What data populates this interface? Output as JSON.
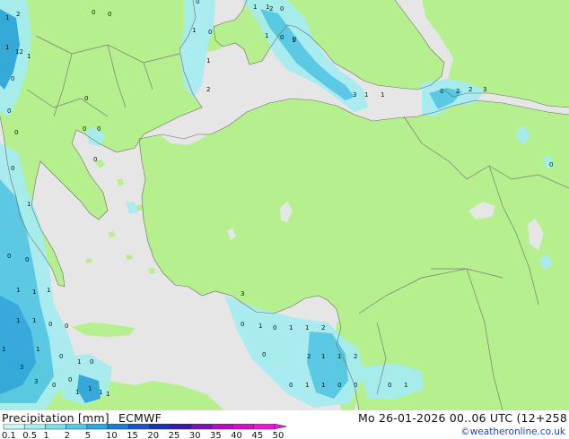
{
  "legend": {
    "title": "Precipitation [mm]",
    "model": "ECMWF",
    "ticks": [
      "0.1",
      "0.5",
      "1",
      "2",
      "5",
      "10",
      "15",
      "20",
      "25",
      "30",
      "35",
      "40",
      "45",
      "50"
    ],
    "colors": [
      "#ccf5f5",
      "#a6ecf0",
      "#7cdfe8",
      "#55c8e4",
      "#2fa6dc",
      "#1d7ad6",
      "#1c53c8",
      "#1b34ae",
      "#3a1aa8",
      "#7a14b8",
      "#b010c4",
      "#d20ec8",
      "#e81ad0"
    ]
  },
  "timestamp": "Mo 26-01-2026 00..06 UTC (12+258",
  "credit": "©weatheronline.co.uk",
  "colors": {
    "land": "#b6ef8d",
    "sea": "#e6e6e6",
    "border": "#7a7a7a",
    "coast": "#6b6b6b"
  },
  "map_values": [
    "1",
    "2",
    "0",
    "0",
    "0",
    "1",
    "1",
    "12",
    "1",
    "1",
    "0",
    "1",
    "0",
    "2",
    "0",
    "0",
    "1",
    "1",
    "0",
    "1",
    "3",
    "1",
    "1",
    "0",
    "2",
    "2",
    "3",
    "2",
    "0",
    "0",
    "0",
    "0",
    "0",
    "0",
    "0",
    "1",
    "0",
    "0",
    "1",
    "1",
    "1",
    "3",
    "0",
    "1",
    "0",
    "1",
    "1",
    "2",
    "1",
    "1",
    "0",
    "0",
    "0",
    "2",
    "1",
    "1",
    "2",
    "0",
    "1",
    "0",
    "1",
    "1",
    "1",
    "1",
    "1",
    "3",
    "1",
    "3",
    "0",
    "0",
    "0",
    "1",
    "1",
    "0",
    "0",
    "0",
    "1",
    "0"
  ]
}
